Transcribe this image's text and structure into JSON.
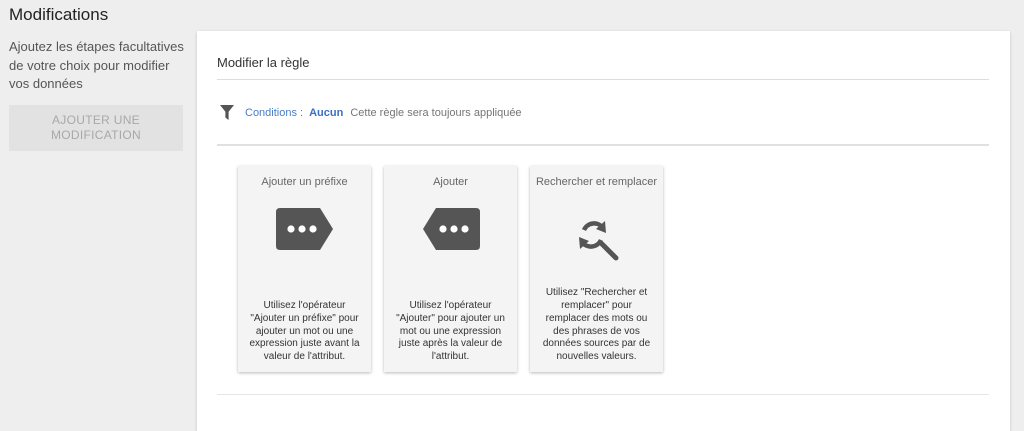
{
  "page": {
    "title": "Modifications"
  },
  "sidebar": {
    "description": "Ajoutez les étapes facultatives de votre choix pour modifier vos données",
    "add_button_label": "AJOUTER UNE MODIFICATION"
  },
  "panel": {
    "title": "Modifier la règle",
    "conditions": {
      "label": "Conditions :",
      "value": "Aucun",
      "description": "Cette règle sera toujours appliquée"
    },
    "cards": [
      {
        "title": "Ajouter un préfixe",
        "icon": "prefix-tag-icon",
        "description": "Utilisez l'opérateur \"Ajouter un préfixe\" pour ajouter un mot ou une expression juste avant la valeur de l'attribut."
      },
      {
        "title": "Ajouter",
        "icon": "append-tag-icon",
        "description": "Utilisez l'opérateur \"Ajouter\" pour ajouter un mot ou une expression juste après la valeur de l'attribut."
      },
      {
        "title": "Rechercher et remplacer",
        "icon": "find-replace-icon",
        "description": "Utilisez \"Rechercher et remplacer\" pour remplacer des mots ou des phrases de vos données sources par de nouvelles valeurs."
      }
    ]
  },
  "colors": {
    "background": "#eeeeee",
    "panel": "#ffffff",
    "card": "#f4f4f4",
    "link_blue": "#4a7dc4",
    "icon_dark": "#555555",
    "disabled_button": "#e2e2e2"
  }
}
